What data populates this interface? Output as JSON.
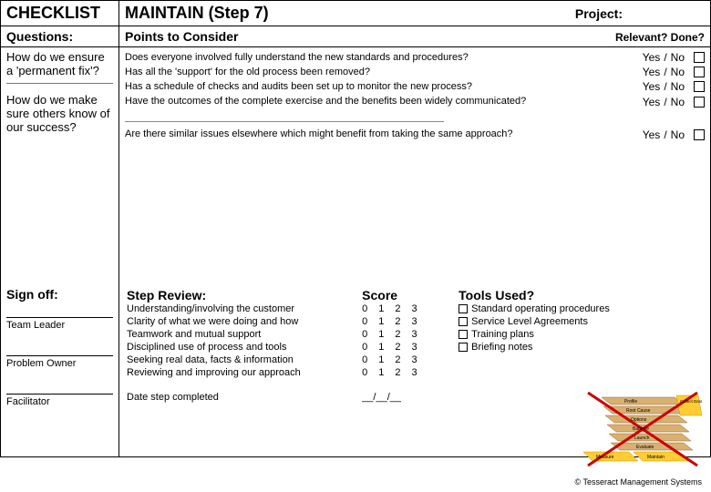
{
  "header": {
    "checklist": "CHECKLIST",
    "step": "MAINTAIN  (Step 7)",
    "project": "Project:",
    "questions": "Questions:",
    "points": "Points to Consider",
    "relevant": "Relevant?",
    "done": "Done?"
  },
  "qa": [
    {
      "question": "How do we ensure a 'permanent fix'?",
      "points": [
        "Does everyone involved fully understand the new standards and procedures?",
        "Has all the 'support' for the old process been removed?",
        "Has a schedule of checks and audits been set up to monitor the new process?",
        "Have the outcomes of the complete exercise and the benefits been widely communicated?"
      ]
    },
    {
      "question": "How do we make sure others know of our success?",
      "points": [
        "Are there similar issues elsewhere which might benefit from taking the same approach?"
      ]
    }
  ],
  "yn": {
    "yes": "Yes",
    "sep": "/",
    "no": "No"
  },
  "signoff": {
    "title": "Sign off:",
    "roles": [
      "Team Leader",
      "Problem Owner",
      "Facilitator"
    ]
  },
  "review": {
    "title": "Step Review:",
    "score": "Score",
    "scores": [
      "0",
      "1",
      "2",
      "3"
    ],
    "items": [
      "Understanding/involving the customer",
      "Clarity of what we were doing and how",
      "Teamwork and mutual support",
      "Disciplined use of process and tools",
      "Seeking real data, facts & information",
      "Reviewing and improving our approach"
    ],
    "date_label": "Date step completed",
    "date_blank": "__/__/__"
  },
  "tools": {
    "title": "Tools Used?",
    "items": [
      "Standard operating procedures",
      "Service Level Agreements",
      "Training plans",
      "Briefing notes"
    ]
  },
  "diagram": {
    "labels": [
      "Profile",
      "Root Cause",
      "Options",
      "Balance",
      "Launch",
      "Evaluate",
      "Measure",
      "Maintain",
      "Collect Data"
    ]
  },
  "copyright": "© Tesseract Management Systems"
}
